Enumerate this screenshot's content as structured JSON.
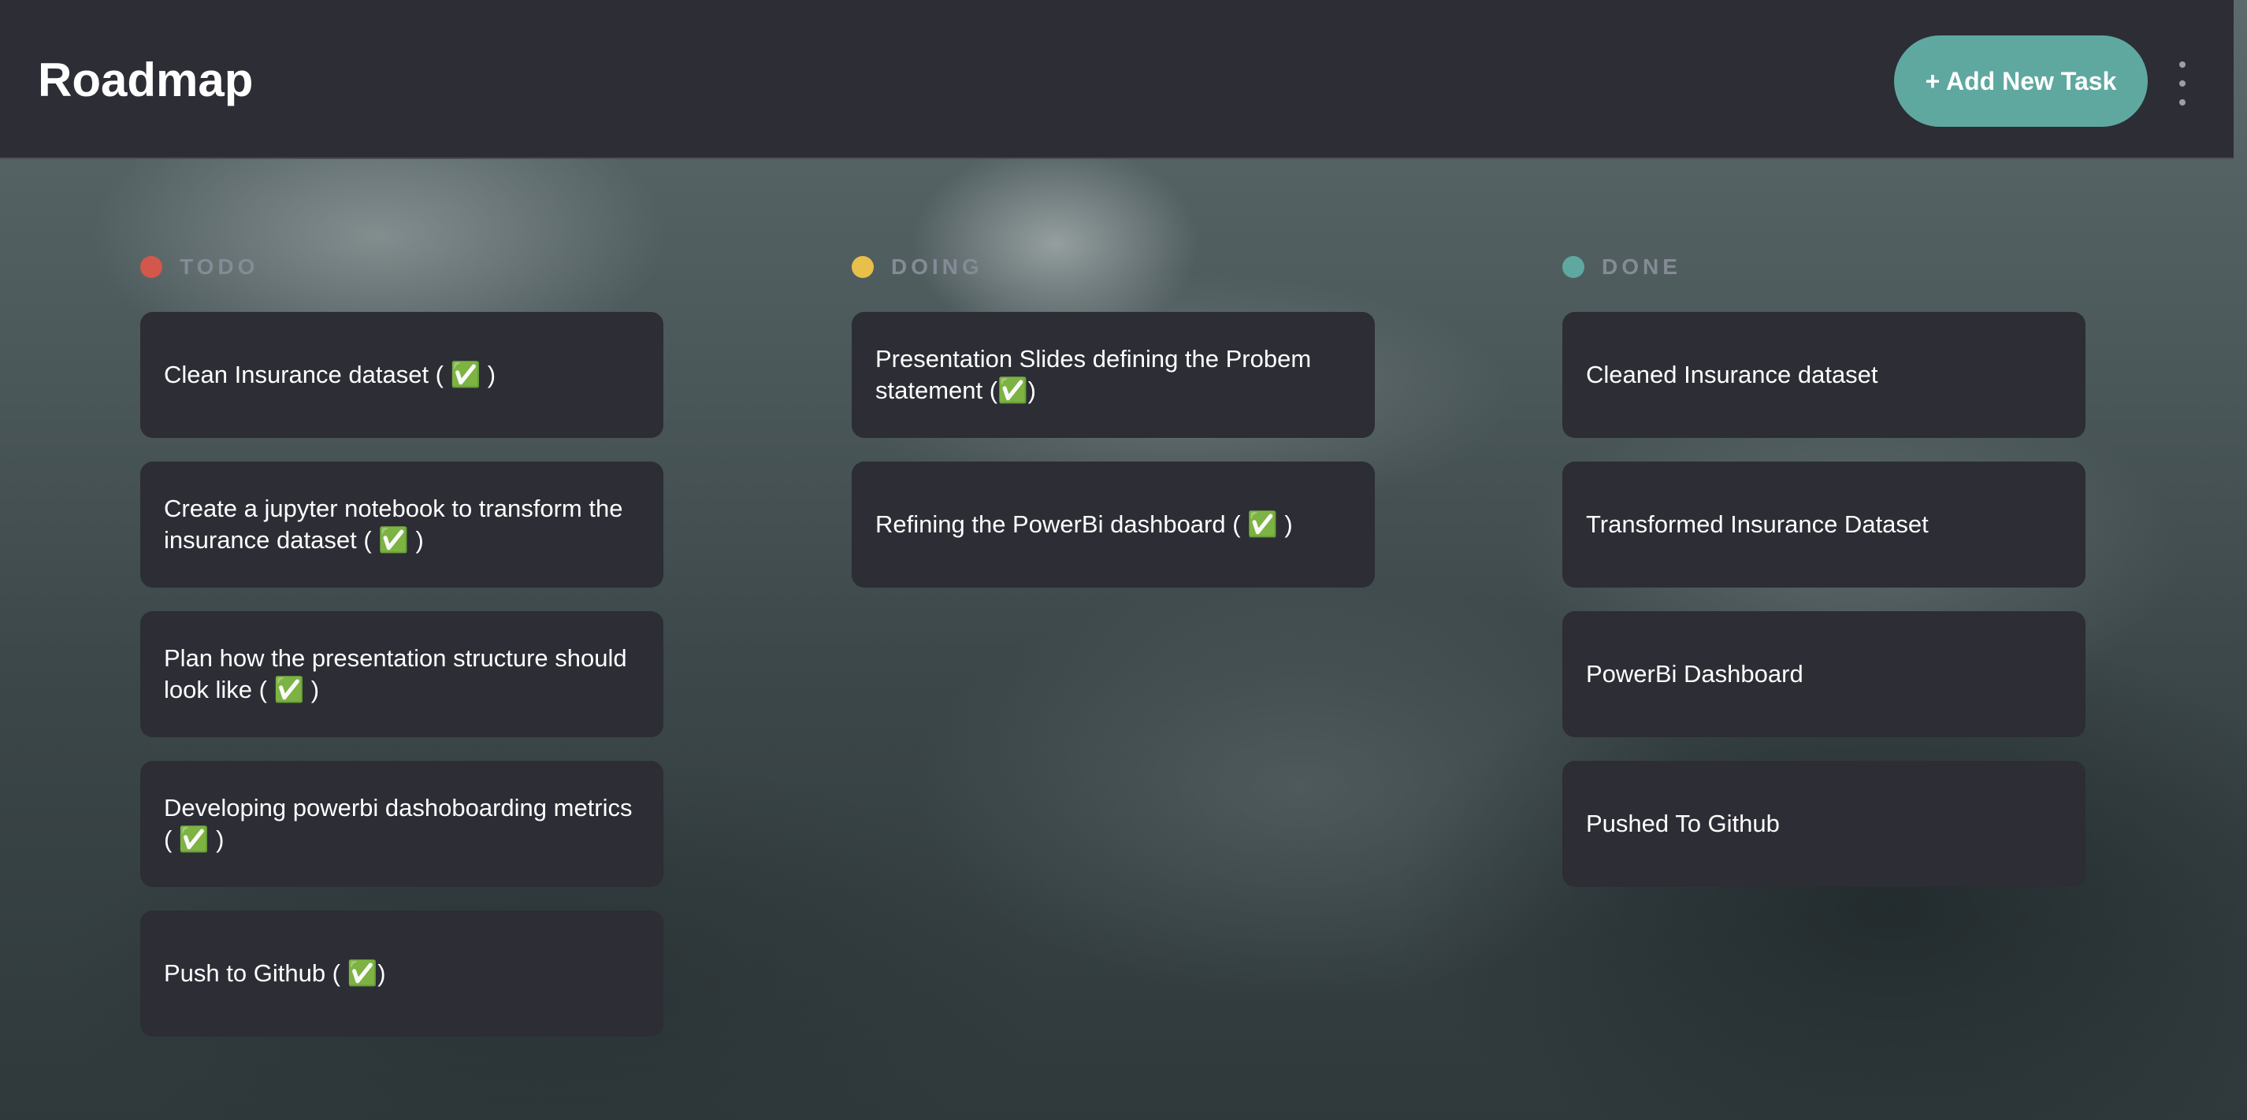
{
  "header": {
    "title": "Roadmap",
    "add_task_label": "+ Add New Task",
    "more_icon": "vertical-ellipsis"
  },
  "colors": {
    "todo": "#d4574b",
    "doing": "#e8bf4b",
    "done": "#5fa8a0",
    "card_bg": "#2c2d35",
    "accent": "#5fa8a0"
  },
  "columns": [
    {
      "title": "TODO",
      "cards": [
        "Clean Insurance dataset ( ✅ )",
        "Create a jupyter notebook to transform the insurance dataset ( ✅ )",
        "Plan how the presentation structure should look like ( ✅ )",
        "Developing powerbi dashoboarding metrics ( ✅ )",
        "Push to Github ( ✅)"
      ]
    },
    {
      "title": "DOING",
      "cards": [
        "Presentation Slides defining the Probem statement (✅)",
        "Refining the PowerBi dashboard ( ✅ )"
      ]
    },
    {
      "title": "DONE",
      "cards": [
        "Cleaned Insurance dataset",
        "Transformed Insurance Dataset",
        "PowerBi Dashboard",
        "Pushed To Github"
      ]
    }
  ]
}
